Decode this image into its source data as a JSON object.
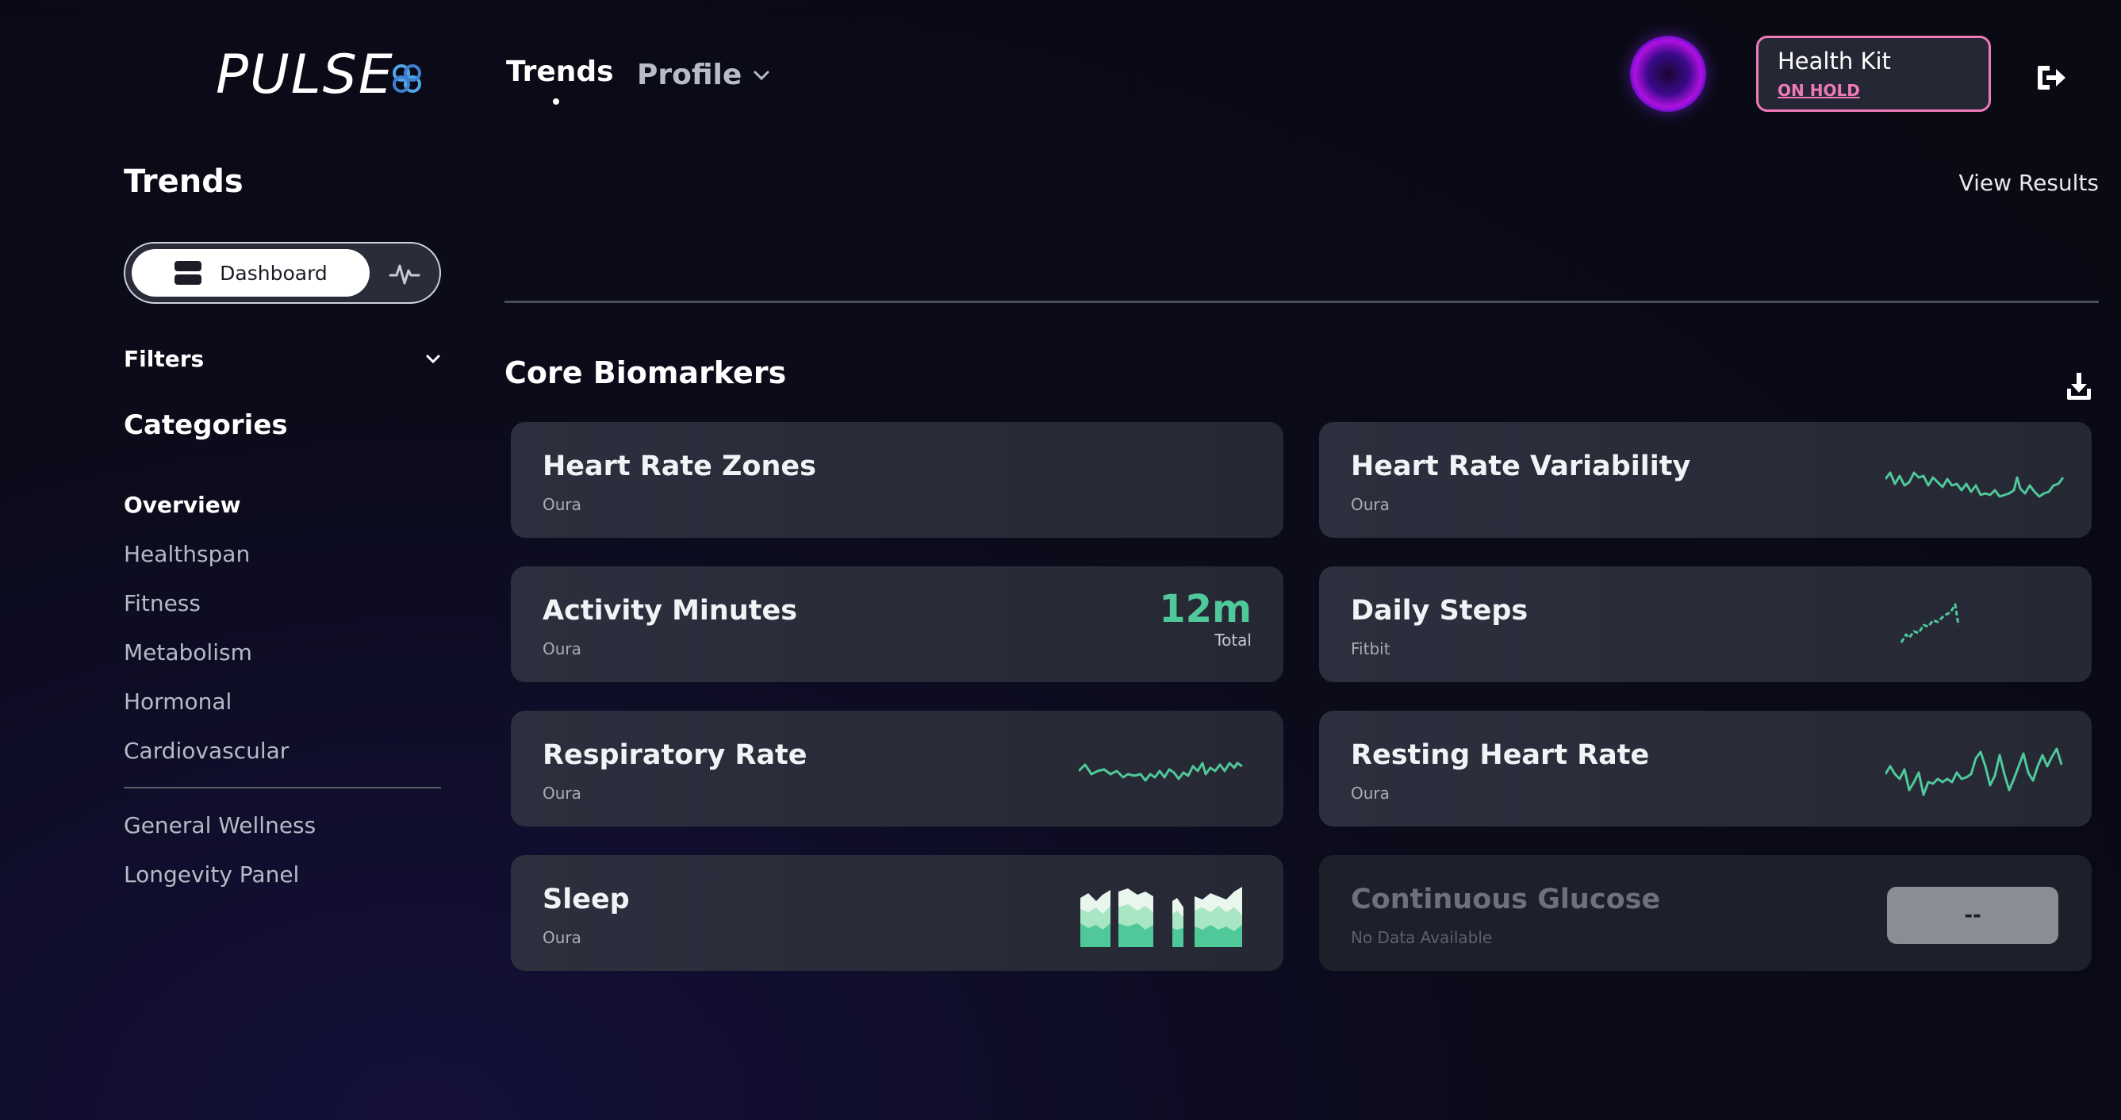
{
  "header": {
    "logo_text": "PULSE",
    "nav": {
      "trends": "Trends",
      "profile": "Profile"
    },
    "health_kit": {
      "title": "Health Kit",
      "status": "ON HOLD",
      "status_color": "#ef7ab8"
    }
  },
  "sidebar": {
    "title": "Trends",
    "view_toggle": {
      "dashboard_label": "Dashboard",
      "alt_view_icon": "pulse-icon"
    },
    "filters_label": "Filters",
    "categories_title": "Categories",
    "categories": [
      {
        "label": "Overview",
        "active": true
      },
      {
        "label": "Healthspan",
        "active": false
      },
      {
        "label": "Fitness",
        "active": false
      },
      {
        "label": "Metabolism",
        "active": false
      },
      {
        "label": "Hormonal",
        "active": false
      },
      {
        "label": "Cardiovascular",
        "active": false
      }
    ],
    "panels": [
      {
        "label": "General Wellness"
      },
      {
        "label": "Longevity Panel"
      }
    ]
  },
  "main": {
    "view_results": "View Results",
    "section_title": "Core Biomarkers",
    "accent_color": "#4fc99a",
    "cards": [
      {
        "name": "Heart Rate Zones",
        "source": "Oura"
      },
      {
        "name": "Heart Rate Variability",
        "source": "Oura",
        "chart": "sparkline"
      },
      {
        "name": "Activity Minutes",
        "source": "Oura",
        "value": "12m",
        "value_caption": "Total"
      },
      {
        "name": "Daily Steps",
        "source": "Fitbit",
        "chart": "sparkline"
      },
      {
        "name": "Respiratory Rate",
        "source": "Oura",
        "chart": "sparkline"
      },
      {
        "name": "Resting Heart Rate",
        "source": "Oura",
        "chart": "sparkline"
      },
      {
        "name": "Sleep",
        "source": "Oura",
        "chart": "stacked-area"
      },
      {
        "name": "Continuous Glucose",
        "source": "No Data Available",
        "value": "--",
        "disabled": true
      }
    ]
  }
}
